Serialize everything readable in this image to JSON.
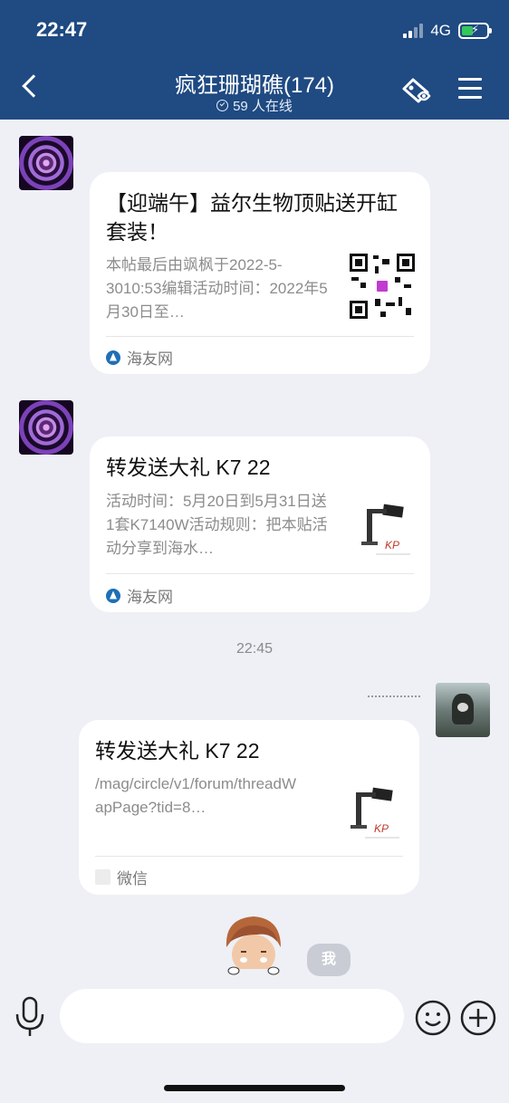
{
  "status_bar": {
    "time": "22:47",
    "network": "4G"
  },
  "header": {
    "title": "疯狂珊瑚礁(174)",
    "subtitle": "59 人在线"
  },
  "messages": [
    {
      "title": "【迎端午】益尔生物顶贴送开缸套装！",
      "desc": "本帖最后由飒枫于2022-5-3010:53编辑活动时间：2022年5月30日至…",
      "source": "海友网",
      "thumb": "qr-code"
    },
    {
      "title": "转发送大礼 K7 22",
      "desc": "活动时间：5月20日到5月31日送1套K7140W活动规则：把本贴活动分享到海水…",
      "source": "海友网",
      "thumb": "lamp"
    },
    {
      "title": "转发送大礼 K7 22",
      "desc": "/mag/circle/v1/forum/threadWapPage?tid=8…",
      "source": "微信",
      "thumb": "lamp"
    }
  ],
  "time_separator": "22:45",
  "me_label": "我",
  "input": {
    "placeholder": ""
  }
}
